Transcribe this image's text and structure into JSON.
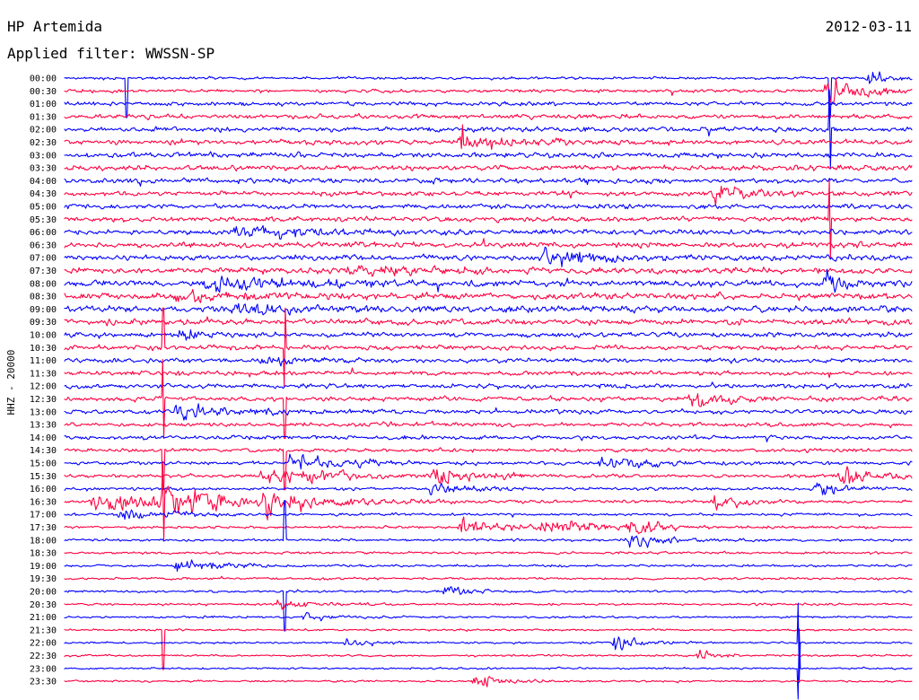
{
  "header": {
    "station": "HP Artemida",
    "filter": "Applied filter: WWSSN-SP",
    "date": "2012-03-11"
  },
  "chart_data": {
    "type": "line",
    "title": "HP Artemida",
    "subtitle": "Applied filter: WWSSN-SP",
    "date": "2012-03-11",
    "ylabel": "HHZ - 20000",
    "xlabel": "",
    "row_interval_minutes": 30,
    "row_labels": [
      "00:00",
      "00:30",
      "01:00",
      "01:30",
      "02:00",
      "02:30",
      "03:00",
      "03:30",
      "04:00",
      "04:30",
      "05:00",
      "05:30",
      "06:00",
      "06:30",
      "07:00",
      "07:30",
      "08:00",
      "08:30",
      "09:00",
      "09:30",
      "10:00",
      "10:30",
      "11:00",
      "11:30",
      "12:00",
      "12:30",
      "13:00",
      "13:30",
      "14:00",
      "14:30",
      "15:00",
      "15:30",
      "16:00",
      "16:30",
      "17:00",
      "17:30",
      "18:00",
      "18:30",
      "19:00",
      "19:30",
      "20:00",
      "20:30",
      "21:00",
      "21:30",
      "22:00",
      "22:30",
      "23:00",
      "23:30"
    ],
    "trace_colors": [
      "#0000ff",
      "#ff0040"
    ],
    "noise_profile": [
      0.55,
      0.75,
      0.85,
      0.95,
      1.0,
      1.0,
      1.05,
      1.1,
      1.05,
      1.0,
      1.0,
      1.05,
      1.1,
      1.15,
      1.2,
      1.25,
      1.3,
      1.35,
      1.35,
      1.25,
      1.05,
      1.0,
      0.95,
      0.95,
      0.95,
      0.9,
      0.9,
      0.9,
      0.85,
      0.8,
      0.75,
      0.7,
      0.65,
      0.6,
      0.55,
      0.55,
      0.55,
      0.52,
      0.5,
      0.5,
      0.48,
      0.46,
      0.44,
      0.42,
      0.42,
      0.4,
      0.4,
      0.4
    ],
    "events": [
      {
        "row": 0,
        "minute": 28.5,
        "amp": 3.0,
        "dur": 0.6
      },
      {
        "row": 1,
        "minute": 27.0,
        "amp": 6.0,
        "dur": 0.9
      },
      {
        "row": 5,
        "minute": 14.0,
        "amp": 2.4,
        "dur": 1.8
      },
      {
        "row": 9,
        "minute": 23.0,
        "amp": 3.5,
        "dur": 1.0
      },
      {
        "row": 12,
        "minute": 6.0,
        "amp": 2.0,
        "dur": 2.5
      },
      {
        "row": 14,
        "minute": 17.0,
        "amp": 2.2,
        "dur": 2.0
      },
      {
        "row": 15,
        "minute": 10.0,
        "amp": 2.0,
        "dur": 2.5
      },
      {
        "row": 16,
        "minute": 5.0,
        "amp": 2.5,
        "dur": 2.5
      },
      {
        "row": 16,
        "minute": 27.0,
        "amp": 6.0,
        "dur": 0.5
      },
      {
        "row": 17,
        "minute": 4.0,
        "amp": 2.0,
        "dur": 2.0
      },
      {
        "row": 18,
        "minute": 6.0,
        "amp": 1.8,
        "dur": 2.0
      },
      {
        "row": 20,
        "minute": 4.0,
        "amp": 3.0,
        "dur": 0.6
      },
      {
        "row": 22,
        "minute": 7.0,
        "amp": 2.4,
        "dur": 1.0
      },
      {
        "row": 25,
        "minute": 22.0,
        "amp": 2.5,
        "dur": 1.5
      },
      {
        "row": 26,
        "minute": 4.0,
        "amp": 2.0,
        "dur": 2.5
      },
      {
        "row": 30,
        "minute": 8.0,
        "amp": 3.0,
        "dur": 1.8
      },
      {
        "row": 30,
        "minute": 19.0,
        "amp": 2.5,
        "dur": 1.5
      },
      {
        "row": 31,
        "minute": 7.0,
        "amp": 3.5,
        "dur": 2.0
      },
      {
        "row": 31,
        "minute": 13.0,
        "amp": 2.5,
        "dur": 1.5
      },
      {
        "row": 31,
        "minute": 27.5,
        "amp": 3.0,
        "dur": 1.2
      },
      {
        "row": 32,
        "minute": 13.0,
        "amp": 2.5,
        "dur": 1.0
      },
      {
        "row": 32,
        "minute": 26.5,
        "amp": 2.2,
        "dur": 1.0
      },
      {
        "row": 33,
        "minute": 1.0,
        "amp": 4.0,
        "dur": 2.5
      },
      {
        "row": 33,
        "minute": 3.5,
        "amp": 3.5,
        "dur": 2.5
      },
      {
        "row": 33,
        "minute": 7.0,
        "amp": 3.5,
        "dur": 2.0
      },
      {
        "row": 33,
        "minute": 23.0,
        "amp": 2.5,
        "dur": 1.0
      },
      {
        "row": 34,
        "minute": 2.0,
        "amp": 2.5,
        "dur": 1.5
      },
      {
        "row": 35,
        "minute": 14.0,
        "amp": 3.0,
        "dur": 1.5
      },
      {
        "row": 35,
        "minute": 17.0,
        "amp": 3.0,
        "dur": 1.5
      },
      {
        "row": 35,
        "minute": 20.0,
        "amp": 2.5,
        "dur": 1.0
      },
      {
        "row": 36,
        "minute": 20.0,
        "amp": 2.5,
        "dur": 1.0
      },
      {
        "row": 38,
        "minute": 4.0,
        "amp": 3.0,
        "dur": 1.2
      },
      {
        "row": 40,
        "minute": 13.5,
        "amp": 1.8,
        "dur": 0.8
      },
      {
        "row": 41,
        "minute": 7.5,
        "amp": 1.8,
        "dur": 1.2
      },
      {
        "row": 42,
        "minute": 8.5,
        "amp": 1.6,
        "dur": 0.8
      },
      {
        "row": 44,
        "minute": 10.0,
        "amp": 1.5,
        "dur": 0.8
      },
      {
        "row": 44,
        "minute": 19.5,
        "amp": 2.5,
        "dur": 0.8
      },
      {
        "row": 45,
        "minute": 22.5,
        "amp": 2.0,
        "dur": 0.6
      },
      {
        "row": 47,
        "minute": 14.5,
        "amp": 2.2,
        "dur": 1.0
      }
    ],
    "spikes": [
      {
        "row": 0,
        "minute": 2.2,
        "amp": 8
      },
      {
        "row": 0,
        "minute": 27.1,
        "amp": 12
      },
      {
        "row": 4,
        "minute": 27.1,
        "amp": 10
      },
      {
        "row": 11,
        "minute": 27.1,
        "amp": 8
      },
      {
        "row": 21,
        "minute": 3.5,
        "amp": 5
      },
      {
        "row": 21,
        "minute": 7.8,
        "amp": 5
      },
      {
        "row": 25,
        "minute": 3.5,
        "amp": 6
      },
      {
        "row": 25,
        "minute": 7.8,
        "amp": 6
      },
      {
        "row": 29,
        "minute": 3.5,
        "amp": 8
      },
      {
        "row": 29,
        "minute": 7.8,
        "amp": 10
      },
      {
        "row": 33,
        "minute": 3.5,
        "amp": 8
      },
      {
        "row": 36,
        "minute": 7.8,
        "amp": 10
      },
      {
        "row": 40,
        "minute": 7.8,
        "amp": 6
      },
      {
        "row": 43,
        "minute": 3.5,
        "amp": 8
      },
      {
        "row": 44,
        "minute": 26.0,
        "amp": 6
      },
      {
        "row": 46,
        "minute": 26.0,
        "amp": 6
      }
    ]
  }
}
